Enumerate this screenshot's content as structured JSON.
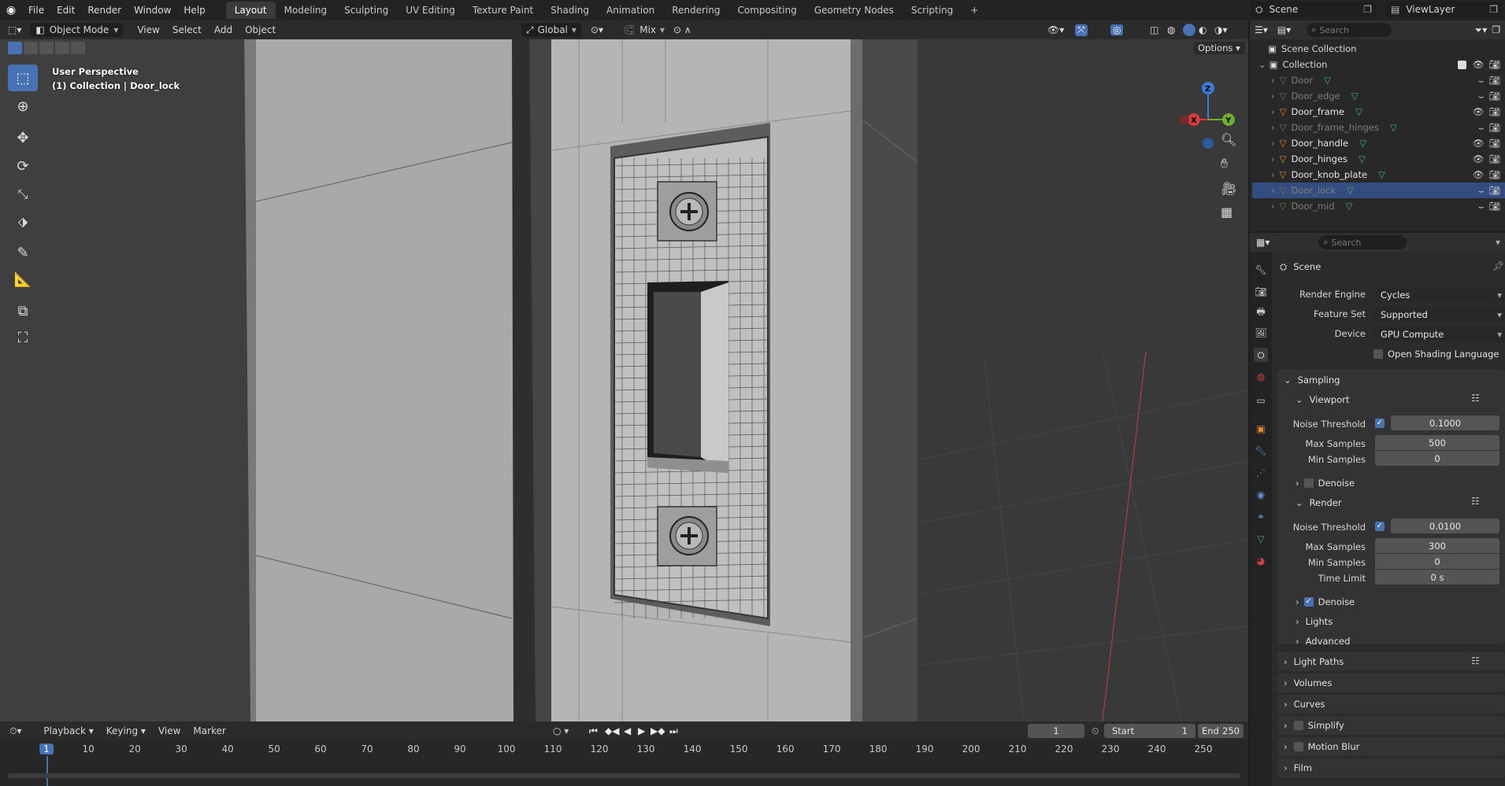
{
  "menus": [
    "File",
    "Edit",
    "Render",
    "Window",
    "Help"
  ],
  "workspaces": [
    "Layout",
    "Modeling",
    "Sculpting",
    "UV Editing",
    "Texture Paint",
    "Shading",
    "Animation",
    "Rendering",
    "Compositing",
    "Geometry Nodes",
    "Scripting"
  ],
  "active_workspace": "Layout",
  "top_right": {
    "scene": "Scene",
    "view_layer": "ViewLayer"
  },
  "viewport_header": {
    "mode": "Object Mode",
    "menus": [
      "View",
      "Select",
      "Add",
      "Object"
    ],
    "orientation": "Global",
    "mix": "Mix",
    "options": "Options"
  },
  "viewport_overlay": {
    "perspective": "User Perspective",
    "collection_info": "(1) Collection | Door_lock"
  },
  "gizmo": {
    "z": "Z",
    "x": "X",
    "y": "Y"
  },
  "outliner": {
    "search_placeholder": "Search",
    "scene_collection": "Scene Collection",
    "collection": "Collection",
    "items": [
      {
        "name": "Door",
        "visible": false,
        "selected": false
      },
      {
        "name": "Door_edge",
        "visible": false,
        "selected": false
      },
      {
        "name": "Door_frame",
        "visible": true,
        "selected": false
      },
      {
        "name": "Door_frame_hinges",
        "visible": false,
        "selected": false
      },
      {
        "name": "Door_handle",
        "visible": true,
        "selected": false
      },
      {
        "name": "Door_hinges",
        "visible": true,
        "selected": false
      },
      {
        "name": "Door_knob_plate",
        "visible": true,
        "selected": false
      },
      {
        "name": "Door_lock",
        "visible": false,
        "selected": true
      },
      {
        "name": "Door_mid",
        "visible": false,
        "selected": false
      }
    ]
  },
  "properties": {
    "search_placeholder": "Search",
    "context": "Scene",
    "render_engine_label": "Render Engine",
    "render_engine": "Cycles",
    "feature_set_label": "Feature Set",
    "feature_set": "Supported",
    "device_label": "Device",
    "device": "GPU Compute",
    "osl_label": "Open Shading Language",
    "sampling": "Sampling",
    "viewport": "Viewport",
    "noise_threshold_label": "Noise Threshold",
    "viewport_noise_threshold": "0.1000",
    "max_samples_label": "Max Samples",
    "viewport_max_samples": "500",
    "min_samples_label": "Min Samples",
    "viewport_min_samples": "0",
    "denoise_label": "Denoise",
    "render": "Render",
    "render_noise_threshold": "0.0100",
    "render_max_samples": "300",
    "render_min_samples": "0",
    "time_limit_label": "Time Limit",
    "time_limit": "0 s",
    "lights": "Lights",
    "advanced": "Advanced",
    "light_paths": "Light Paths",
    "volumes": "Volumes",
    "curves": "Curves",
    "simplify": "Simplify",
    "motion_blur": "Motion Blur",
    "film": "Film"
  },
  "timeline": {
    "menus": [
      "Playback",
      "Keying",
      "View",
      "Marker"
    ],
    "current_frame": "1",
    "start_label": "Start",
    "start": "1",
    "end_label": "End",
    "end": "250",
    "ruler": [
      "1",
      "10",
      "20",
      "30",
      "40",
      "50",
      "60",
      "70",
      "80",
      "90",
      "100",
      "110",
      "120",
      "130",
      "140",
      "150",
      "160",
      "170",
      "180",
      "190",
      "200",
      "210",
      "220",
      "230",
      "240",
      "250"
    ]
  },
  "colors": {
    "accent": "#4772b3",
    "selected_row": "#334d80",
    "x_axis": "#d83c3c",
    "y_axis": "#6fae2f",
    "z_axis": "#3b7bd8"
  }
}
